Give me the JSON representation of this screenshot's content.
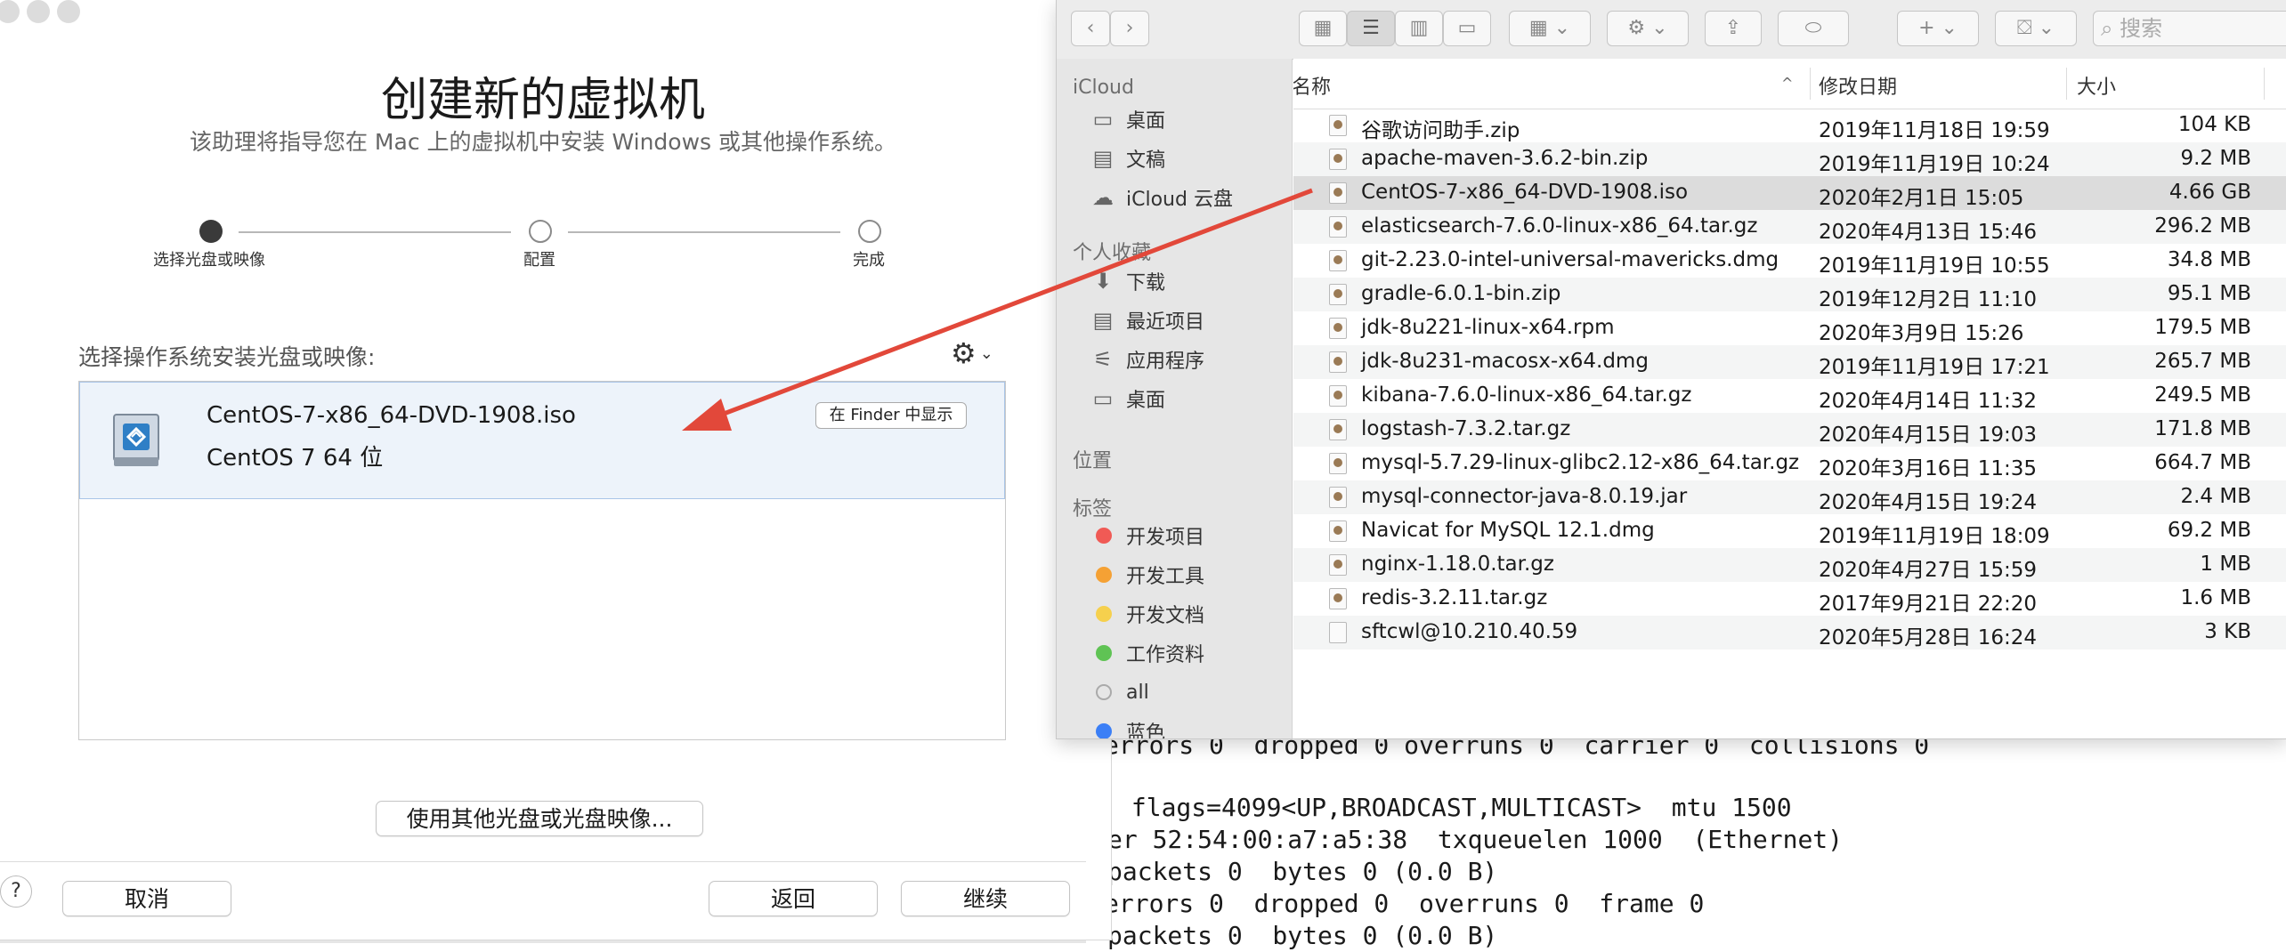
{
  "vm_dialog": {
    "title": "创建新的虚拟机",
    "subtitle": "该助理将指导您在 Mac 上的虚拟机中安装 Windows 或其他操作系统。",
    "steps": [
      "选择光盘或映像",
      "配置",
      "完成"
    ],
    "select_label": "选择操作系统安装光盘或映像:",
    "disk": {
      "name": "CentOS-7-x86_64-DVD-1908.iso",
      "os": "CentOS 7 64 位",
      "show_in_finder": "在 Finder 中显示"
    },
    "use_other_button": "使用其他光盘或光盘映像...",
    "help": "?",
    "cancel_button": "取消",
    "back_button": "返回",
    "continue_button": "继续"
  },
  "finder": {
    "search_placeholder": "搜索",
    "sidebar": {
      "icloud_header": "iCloud",
      "icloud_items": [
        {
          "label": "桌面",
          "icon": "desktop-icon"
        },
        {
          "label": "文稿",
          "icon": "documents-icon"
        },
        {
          "label": "iCloud 云盘",
          "icon": "cloud-icon"
        }
      ],
      "favorites_header": "个人收藏",
      "favorites_items": [
        {
          "label": "下载",
          "icon": "download-icon"
        },
        {
          "label": "最近项目",
          "icon": "recents-icon"
        },
        {
          "label": "应用程序",
          "icon": "applications-icon"
        },
        {
          "label": "桌面",
          "icon": "desktop-icon"
        }
      ],
      "locations_header": "位置",
      "tags_header": "标签",
      "tags": [
        {
          "label": "开发项目",
          "color": "#f05a55"
        },
        {
          "label": "开发工具",
          "color": "#f5a134"
        },
        {
          "label": "开发文档",
          "color": "#f6d04d"
        },
        {
          "label": "工作资料",
          "color": "#5fc354"
        },
        {
          "label": "all",
          "color": "#e6e6e6"
        },
        {
          "label": "蓝色",
          "color": "#3b7ff6"
        }
      ]
    },
    "columns": {
      "name": "名称",
      "date": "修改日期",
      "size": "大小"
    },
    "files": [
      {
        "name": "谷歌访问助手.zip",
        "date": "2019年11月18日 19:59",
        "size": "104 KB"
      },
      {
        "name": "apache-maven-3.6.2-bin.zip",
        "date": "2019年11月19日 10:24",
        "size": "9.2 MB"
      },
      {
        "name": "CentOS-7-x86_64-DVD-1908.iso",
        "date": "2020年2月1日 15:05",
        "size": "4.66 GB"
      },
      {
        "name": "elasticsearch-7.6.0-linux-x86_64.tar.gz",
        "date": "2020年4月13日 15:46",
        "size": "296.2 MB"
      },
      {
        "name": "git-2.23.0-intel-universal-mavericks.dmg",
        "date": "2019年11月19日 10:55",
        "size": "34.8 MB"
      },
      {
        "name": "gradle-6.0.1-bin.zip",
        "date": "2019年12月2日 11:10",
        "size": "95.1 MB"
      },
      {
        "name": "jdk-8u221-linux-x64.rpm",
        "date": "2020年3月9日 15:26",
        "size": "179.5 MB"
      },
      {
        "name": "jdk-8u231-macosx-x64.dmg",
        "date": "2019年11月19日 17:21",
        "size": "265.7 MB"
      },
      {
        "name": "kibana-7.6.0-linux-x86_64.tar.gz",
        "date": "2020年4月14日 11:32",
        "size": "249.5 MB"
      },
      {
        "name": "logstash-7.3.2.tar.gz",
        "date": "2020年4月15日 19:03",
        "size": "171.8 MB"
      },
      {
        "name": "mysql-5.7.29-linux-glibc2.12-x86_64.tar.gz",
        "date": "2020年3月16日 11:35",
        "size": "664.7 MB"
      },
      {
        "name": "mysql-connector-java-8.0.19.jar",
        "date": "2020年4月15日 19:24",
        "size": "2.4 MB"
      },
      {
        "name": "Navicat for MySQL 12.1.dmg",
        "date": "2019年11月19日 18:09",
        "size": "69.2 MB"
      },
      {
        "name": "nginx-1.18.0.tar.gz",
        "date": "2020年4月27日 15:59",
        "size": "1 MB"
      },
      {
        "name": "redis-3.2.11.tar.gz",
        "date": "2017年9月21日 22:20",
        "size": "1.6 MB"
      },
      {
        "name": "sftcwl@10.210.40.59",
        "date": "2020年5月28日 16:24",
        "size": "3 KB"
      }
    ]
  },
  "terminal": {
    "lines": [
      "errors 0  dropped 0 overruns 0  carrier 0  collisions 0",
      " flags=4099<UP,BROADCAST,MULTICAST>  mtu 1500",
      "er 52:54:00:a7:a5:38  txqueuelen 1000  (Ethernet)",
      "packets 0  bytes 0 (0.0 B)",
      "errors 0  dropped 0  overruns 0  frame 0",
      "packets 0  bytes 0 (0.0 B)"
    ]
  },
  "colors": {
    "arrow": "#e2483a",
    "selected_row": "#dcdcdc",
    "disk_highlight": "#edf3fa"
  }
}
